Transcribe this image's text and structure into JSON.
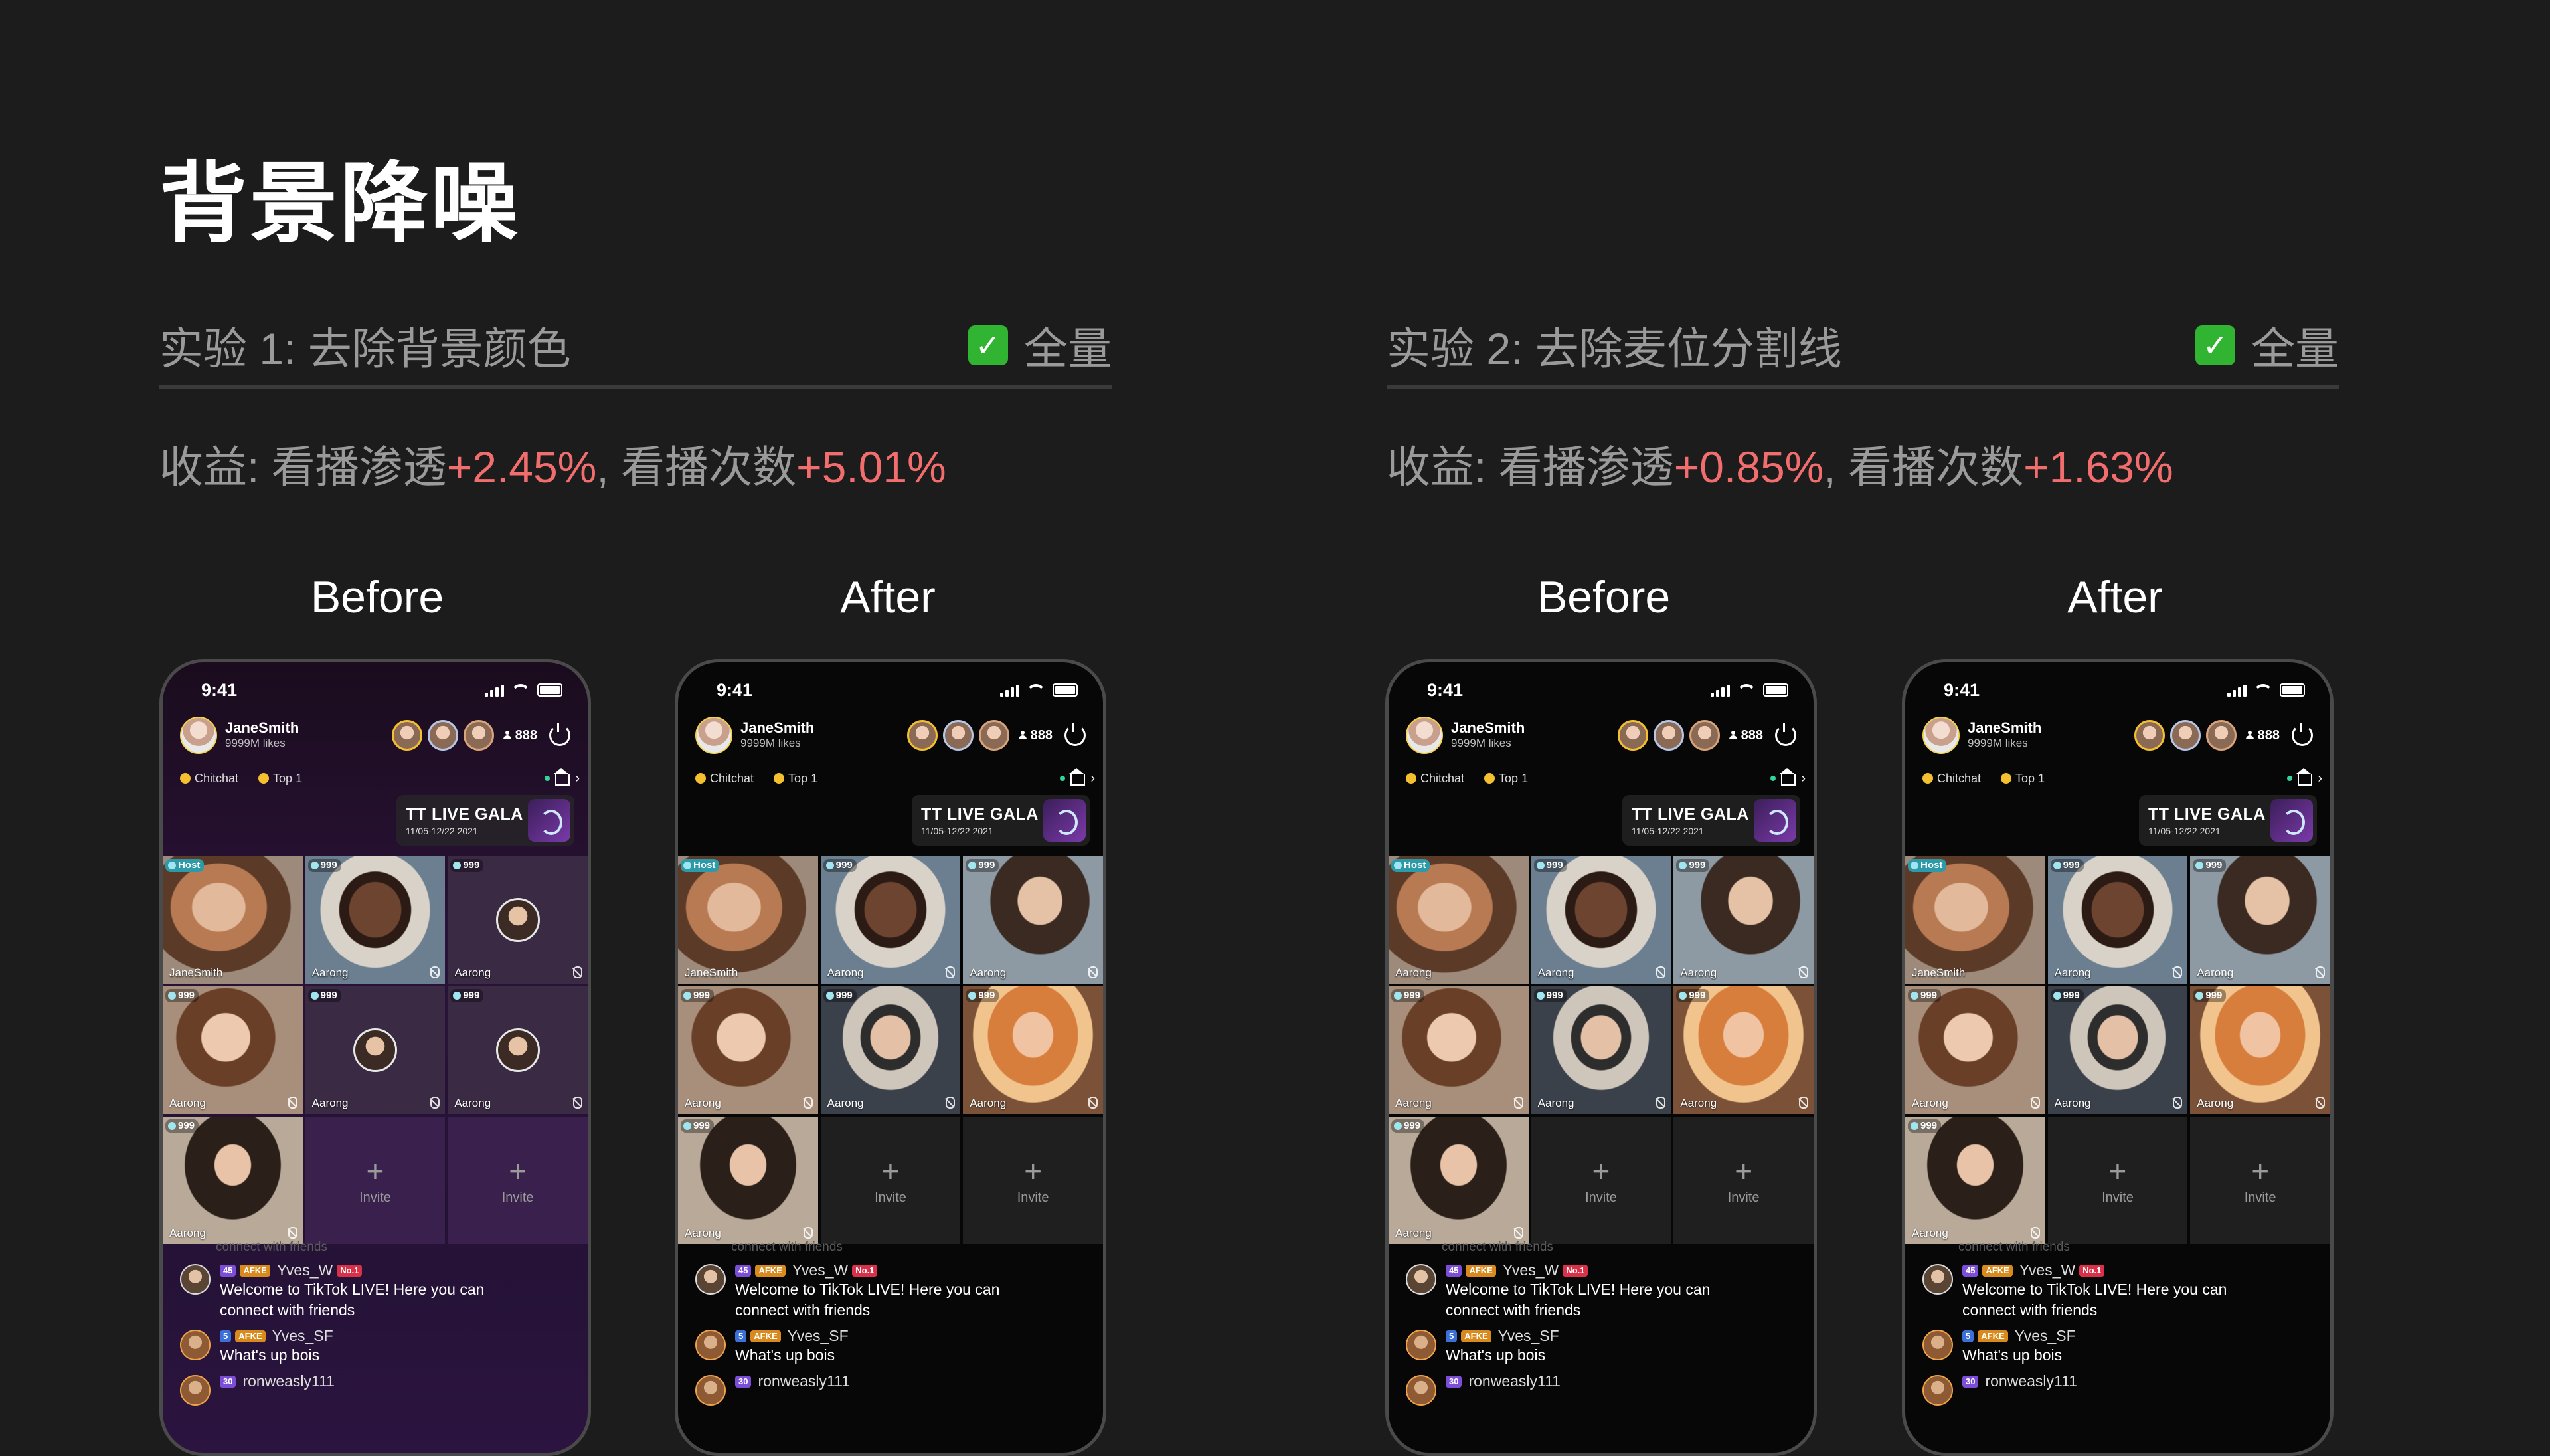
{
  "page_title": "背景降噪",
  "experiments": [
    {
      "name": "实验 1: 去除背景颜色",
      "status_icon": "✅",
      "status": "全量",
      "benefit": {
        "prefix": "收益: 看播渗透",
        "value1": "+2.45%",
        "mid": ", 看播次数",
        "value2": "+5.01%"
      }
    },
    {
      "name": "实验 2: 去除麦位分割线",
      "status_icon": "✅",
      "status": "全量",
      "benefit": {
        "prefix": "收益: 看播渗透",
        "value1": "+0.85%",
        "mid": ", 看播次数",
        "value2": "+1.63%"
      }
    }
  ],
  "labels": {
    "before": "Before",
    "after": "After"
  },
  "phone": {
    "time": "9:41",
    "host_name": "JaneSmith",
    "host_likes": "9999M likes",
    "viewer_count": "888",
    "tag_chitchat": "Chitchat",
    "tag_top": "Top 1",
    "gala_title": "TT LIVE GALA",
    "gala_date": "11/05-12/22 2021",
    "host_badge": "Host",
    "seat_badge": "999",
    "seat_name": "Aarong",
    "host_seat_name": "JaneSmith",
    "invite": "Invite",
    "chat_fade": "connect with friends",
    "messages": [
      {
        "badge_level": "45",
        "badge_afke": "AFKE",
        "user": "Yves_W",
        "rank": "No.1",
        "text": "Welcome to TikTok LIVE! Here you can connect with friends"
      },
      {
        "badge_level": "5",
        "badge_afke": "AFKE",
        "user": "Yves_SF",
        "text": "What's up bois"
      },
      {
        "badge_level": "30",
        "user": "ronweasly111"
      }
    ]
  },
  "colors": {
    "positive": "#f26e6e",
    "background": "#1c1c1c",
    "check_green": "#31b431"
  }
}
